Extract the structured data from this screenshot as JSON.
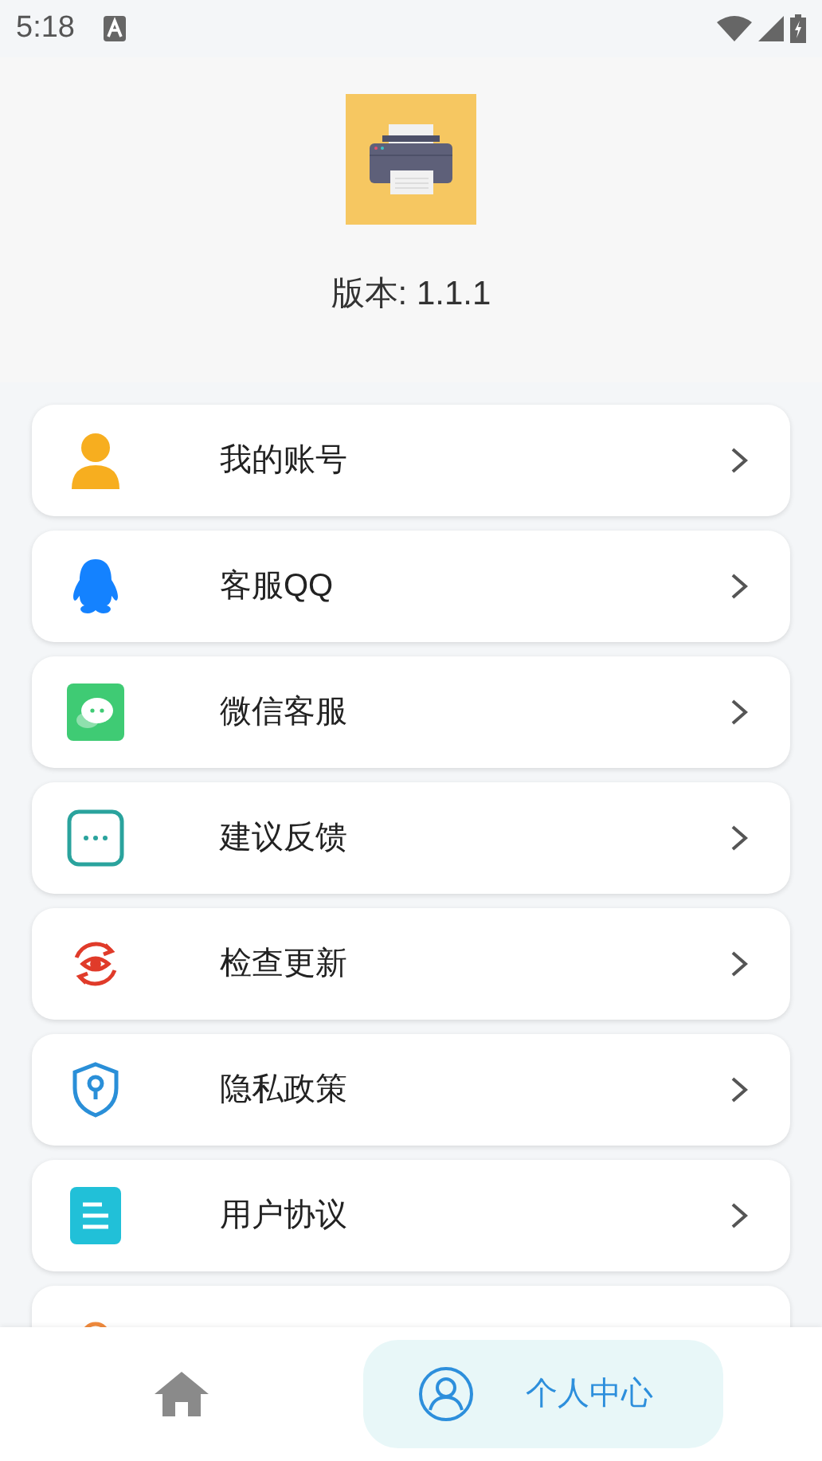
{
  "status_bar": {
    "time": "5:18"
  },
  "header": {
    "version": "版本: 1.1.1"
  },
  "menu": [
    {
      "kind": "account",
      "label": "我的账号"
    },
    {
      "kind": "qq",
      "label": "客服QQ"
    },
    {
      "kind": "wechat",
      "label": "微信客服"
    },
    {
      "kind": "feedback",
      "label": "建议反馈"
    },
    {
      "kind": "update",
      "label": "检查更新"
    },
    {
      "kind": "privacy",
      "label": "隐私政策"
    },
    {
      "kind": "agreement",
      "label": "用户协议"
    },
    {
      "kind": "info"
    }
  ],
  "bottom_nav": [
    {
      "kind": "home",
      "selected": false
    },
    {
      "kind": "profile",
      "label": "个人中心",
      "selected": true
    }
  ]
}
